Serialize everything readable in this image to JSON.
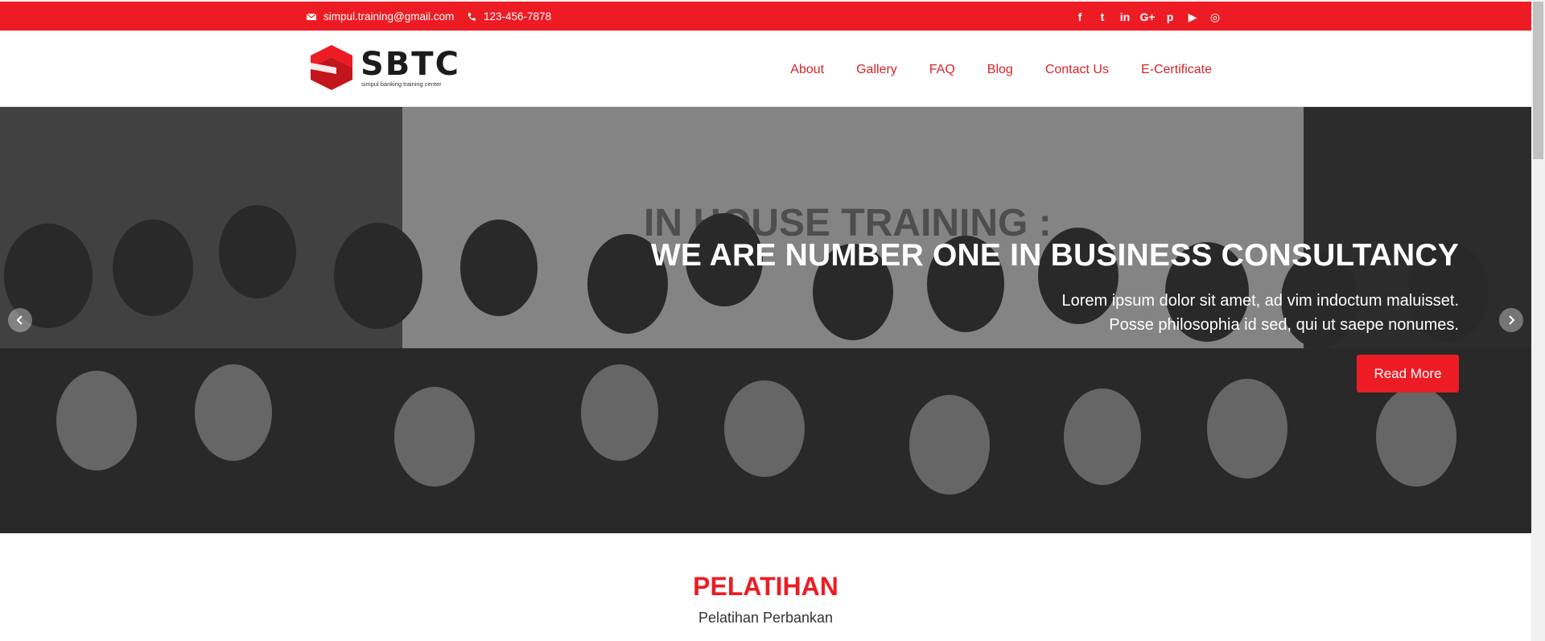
{
  "topbar": {
    "email": "simpul.training@gmail.com",
    "phone": "123-456-7878",
    "social": [
      {
        "icon": "facebook-icon",
        "glyph": "f"
      },
      {
        "icon": "twitter-icon",
        "glyph": "t"
      },
      {
        "icon": "linkedin-icon",
        "glyph": "in"
      },
      {
        "icon": "google-plus-icon",
        "glyph": "G+"
      },
      {
        "icon": "pinterest-icon",
        "glyph": "p"
      },
      {
        "icon": "youtube-icon",
        "glyph": "▶"
      },
      {
        "icon": "instagram-icon",
        "glyph": "◎"
      }
    ]
  },
  "header": {
    "logo_text": "SBTC",
    "logo_tagline": "simpul banking training center",
    "nav": [
      "About",
      "Gallery",
      "FAQ",
      "Blog",
      "Contact Us",
      "E-Certificate"
    ]
  },
  "hero": {
    "heading": "WE ARE NUMBER ONE IN BUSINESS CONSULTANCY",
    "line1": "Lorem ipsum dolor sit amet, ad vim indoctum maluisset.",
    "line2": "Posse philosophia id sed, qui ut saepe nonumes.",
    "button": "Read More",
    "banner_text": "IN HOUSE TRAINING :"
  },
  "section": {
    "title": "PELATIHAN",
    "subtitle": "Pelatihan Perbankan"
  },
  "colors": {
    "brand_red": "#ed1c24",
    "nav_red": "#d9232a"
  }
}
